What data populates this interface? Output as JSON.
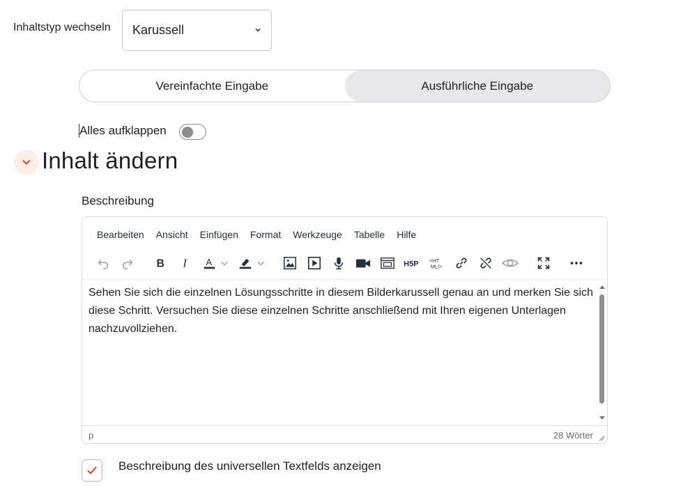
{
  "content_type": {
    "label": "Inhaltstyp wechseln",
    "selected": "Karussell"
  },
  "mode_tabs": [
    {
      "label": "Vereinfachte Eingabe",
      "active": false
    },
    {
      "label": "Ausführliche Eingabe",
      "active": true
    }
  ],
  "expand_all": {
    "label": "Alles aufklappen",
    "on": false
  },
  "section": {
    "title": "Inhalt ändern"
  },
  "description": {
    "label": "Beschreibung",
    "menu": [
      "Bearbeiten",
      "Ansicht",
      "Einfügen",
      "Format",
      "Werkzeuge",
      "Tabelle",
      "Hilfe"
    ],
    "text": "Sehen Sie sich die einzelnen Lösungsschritte in diesem Bilderkarussell genau an und merken Sie sich diese Schritt. Versuchen Sie diese einzelnen Schritte anschließend mit Ihren eigenen Unterlagen nachzuvollziehen.",
    "status_path": "p",
    "word_count": "28 Wörter"
  },
  "show_universal": {
    "label": "Beschreibung des universellen Textfelds anzeigen",
    "checked": true
  },
  "colors": {
    "accent": "#c94b1b",
    "text": "#1d2125",
    "icon": "#222f3e",
    "disabled_icon": "#9a9aa0"
  }
}
